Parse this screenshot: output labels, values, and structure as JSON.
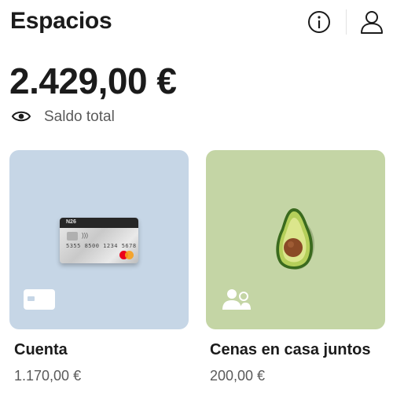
{
  "header": {
    "title": "Espacios",
    "info_icon": "info-icon",
    "profile_icon": "user-icon"
  },
  "balance": {
    "amount": "2.429,00 €",
    "label": "Saldo total",
    "visibility_icon": "eye-icon"
  },
  "spaces": [
    {
      "name": "Cuenta",
      "amount": "1.170,00 €",
      "background": "#c6d6e6",
      "image": "bank-card",
      "icon": "card-icon",
      "card": {
        "brand": "N26",
        "number": "5355 8500 1234 5678"
      }
    },
    {
      "name": "Cenas en casa juntos",
      "amount": "200,00 €",
      "background": "#c4d5a5",
      "image": "avocado",
      "icon": "shared-people-icon"
    }
  ]
}
